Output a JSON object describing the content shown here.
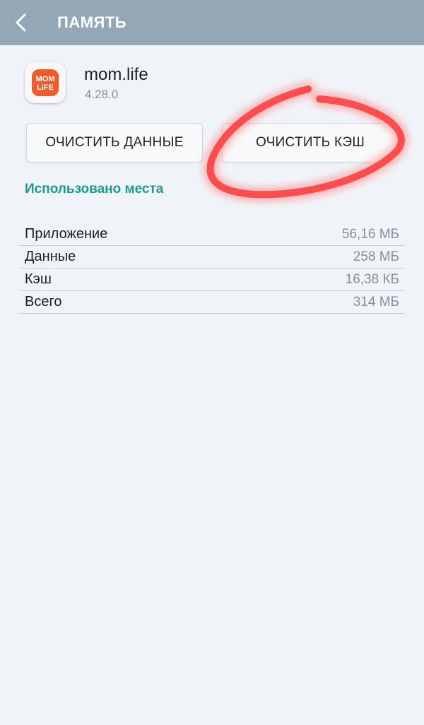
{
  "header": {
    "title": "ПАМЯТЬ",
    "back_icon": "chevron-left-icon"
  },
  "app": {
    "name": "mom.life",
    "version": "4.28.0",
    "icon_text_top": "MOM",
    "icon_text_bottom": "LiFE",
    "icon_color": "#f15a29"
  },
  "buttons": {
    "clear_data": "ОЧИСТИТЬ ДАННЫЕ",
    "clear_cache": "ОЧИСТИТЬ КЭШ"
  },
  "storage": {
    "section_title": "Использовано места",
    "rows": [
      {
        "label": "Приложение",
        "value": "56,16 МБ"
      },
      {
        "label": "Данные",
        "value": "258 МБ"
      },
      {
        "label": "Кэш",
        "value": "16,38 КБ"
      },
      {
        "label": "Всего",
        "value": "314 МБ"
      }
    ]
  },
  "colors": {
    "header_bg": "#93a7b7",
    "accent_teal": "#1a9a8c",
    "annotation_red": "#ff4d4d"
  }
}
